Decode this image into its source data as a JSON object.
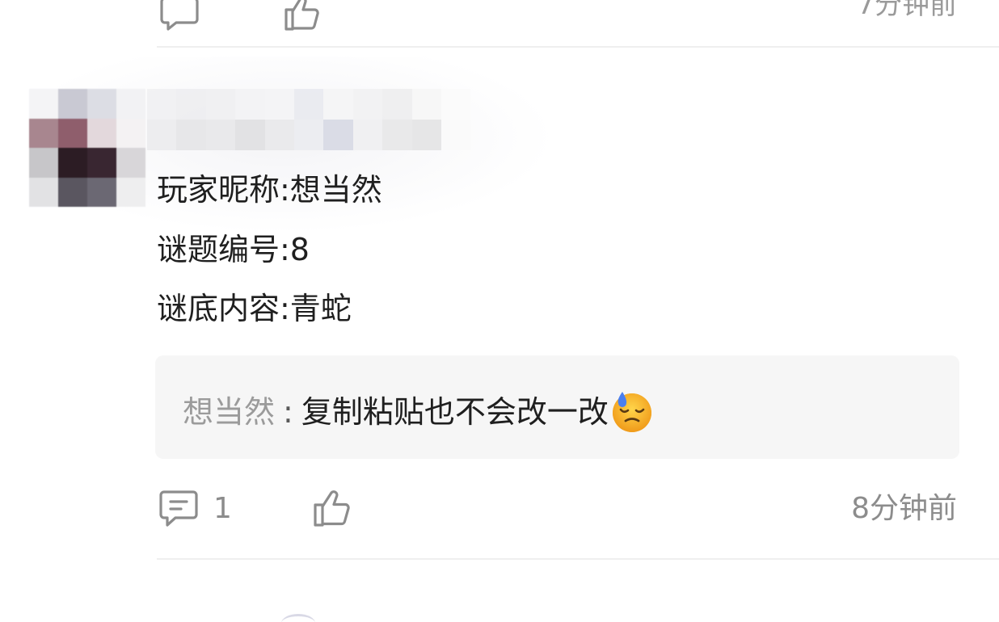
{
  "previous_comment": {
    "time": "7分钟前"
  },
  "comment": {
    "lines": [
      "玩家昵称:想当然",
      "谜题编号:8",
      "谜底内容:青蛇"
    ],
    "reply": {
      "author": "想当然",
      "separator": ":",
      "text": "复制粘贴也不会改一改",
      "emoji": "sweat-face-icon"
    },
    "footer": {
      "comment_count": "1",
      "time": "8分钟前"
    }
  },
  "colors": {
    "background": "#ffffff",
    "reply_background": "#f6f6f6",
    "muted_text": "#8c8c8c",
    "divider": "#efefef"
  }
}
